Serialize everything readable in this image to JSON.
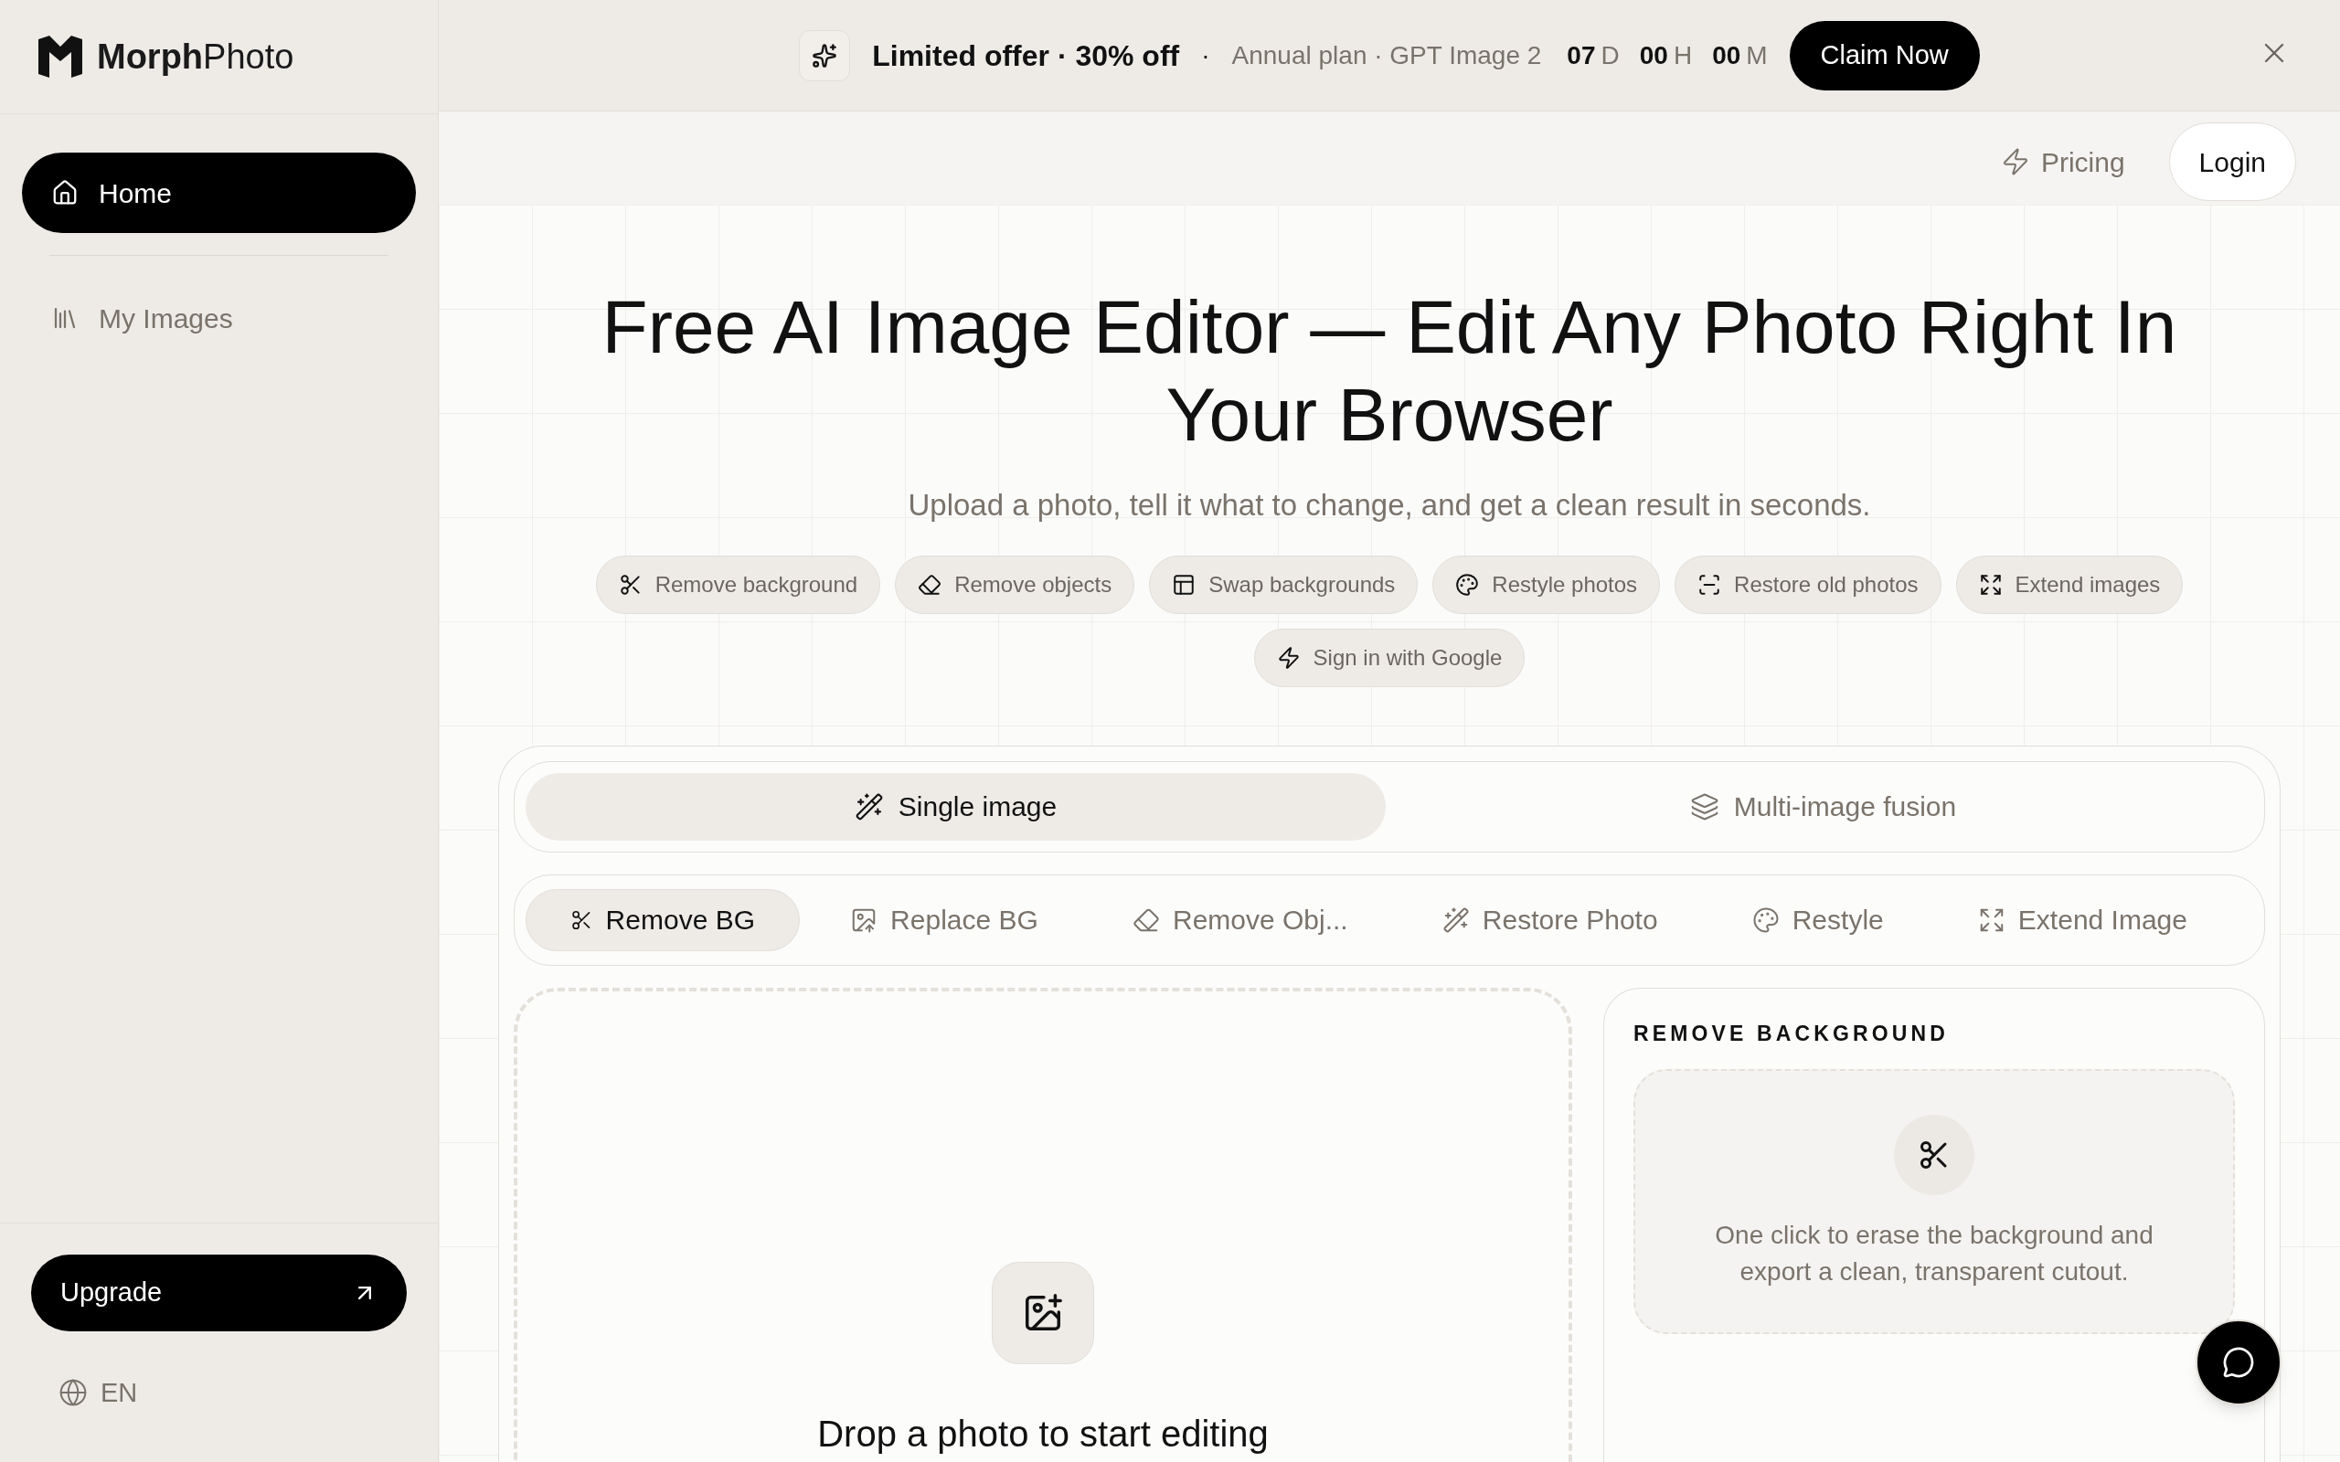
{
  "logo": {
    "text": "**Morph**Photo"
  },
  "sidebar": {
    "items": [
      {
        "label": "Home",
        "selected": true
      },
      {
        "label": "My Images",
        "selected": false
      }
    ],
    "upgrade": "Upgrade",
    "language": "EN"
  },
  "banner": {
    "offer": "Limited offer · 30% off",
    "separator": "·",
    "details": "Annual plan · GPT Image 2",
    "countdown": [
      {
        "value": "07",
        "unit": "D"
      },
      {
        "value": "00",
        "unit": "H"
      },
      {
        "value": "00",
        "unit": "M"
      }
    ],
    "cta": "Claim Now"
  },
  "header": {
    "pricing": "Pricing",
    "login": "Login"
  },
  "hero": {
    "title": "Free AI Image Editor — Edit Any Photo Right In Your Browser",
    "subtitle": "Upload a photo, tell it what to change, and get a clean result in seconds.",
    "chips": [
      "Remove background",
      "Remove objects",
      "Swap backgrounds",
      "Restyle photos",
      "Restore old photos",
      "Extend images"
    ],
    "google": "Sign in with Google"
  },
  "modes": [
    {
      "label": "Single image",
      "selected": true
    },
    {
      "label": "Multi-image fusion",
      "selected": false
    }
  ],
  "tools": [
    {
      "label": "Remove BG",
      "selected": true
    },
    {
      "label": "Replace BG",
      "selected": false
    },
    {
      "label": "Remove Obj...",
      "selected": false
    },
    {
      "label": "Restore Photo",
      "selected": false
    },
    {
      "label": "Restyle",
      "selected": false
    },
    {
      "label": "Extend Image",
      "selected": false
    }
  ],
  "dropzone": {
    "title": "Drop a photo to start editing"
  },
  "panel": {
    "heading": "REMOVE BACKGROUND",
    "description": "One click to erase the background and export a clean, transparent cutout."
  }
}
